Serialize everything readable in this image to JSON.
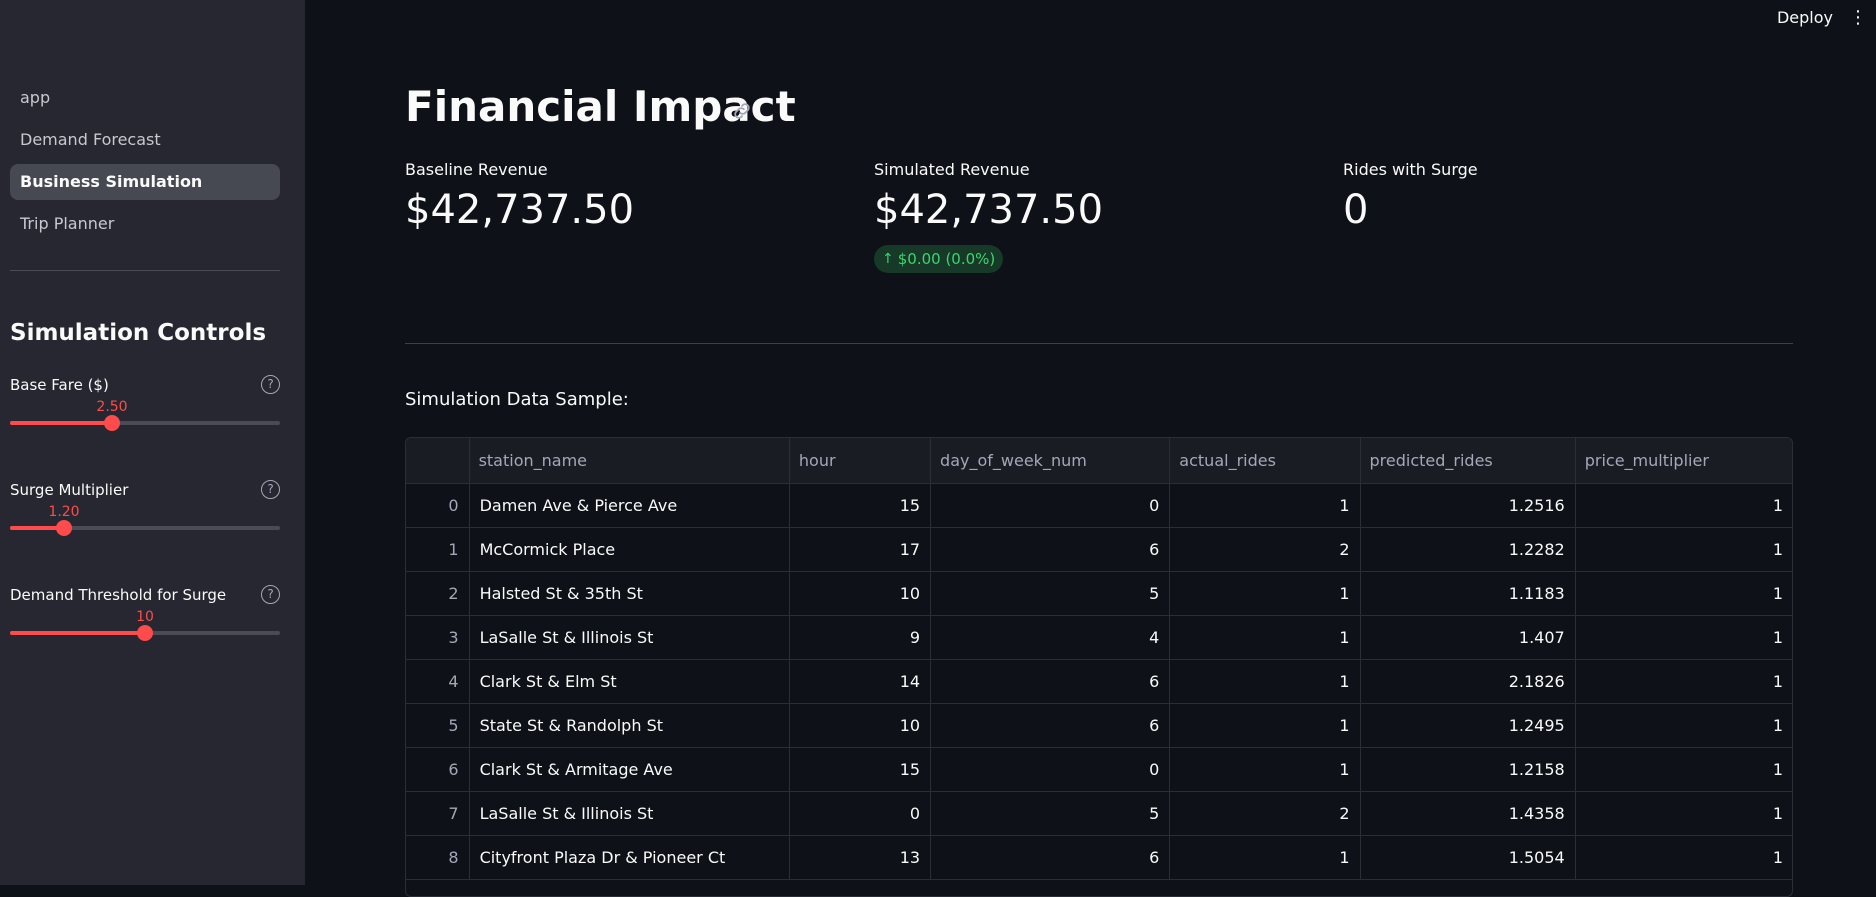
{
  "sidebar": {
    "nav": [
      "app",
      "Demand Forecast",
      "Business Simulation",
      "Trip Planner"
    ],
    "active_nav": "Business Simulation",
    "section_title": "Simulation Controls",
    "sliders": [
      {
        "label": "Base Fare ($)",
        "value": "2.50",
        "fraction": 0.38
      },
      {
        "label": "Surge Multiplier",
        "value": "1.20",
        "fraction": 0.2
      },
      {
        "label": "Demand Threshold for Surge",
        "value": "10",
        "fraction": 0.5
      }
    ],
    "help_icon": "?"
  },
  "topbar": {
    "deploy": "Deploy",
    "menu_icon": "⋮"
  },
  "main": {
    "title": "Financial Impact",
    "metrics": [
      {
        "label": "Baseline Revenue",
        "value": "$42,737.50"
      },
      {
        "label": "Simulated Revenue",
        "value": "$42,737.50",
        "delta": "$0.00 (0.0%)",
        "delta_arrow": "↑"
      },
      {
        "label": "Rides with Surge",
        "value": "0"
      }
    ],
    "section_label": "Simulation Data Sample:",
    "table": {
      "columns": [
        "",
        "station_name",
        "hour",
        "day_of_week_num",
        "actual_rides",
        "predicted_rides",
        "price_multiplier"
      ],
      "rows": [
        [
          "0",
          "Damen Ave & Pierce Ave",
          "15",
          "0",
          "1",
          "1.2516",
          "1"
        ],
        [
          "1",
          "McCormick Place",
          "17",
          "6",
          "2",
          "1.2282",
          "1"
        ],
        [
          "2",
          "Halsted St & 35th St",
          "10",
          "5",
          "1",
          "1.1183",
          "1"
        ],
        [
          "3",
          "LaSalle St & Illinois St",
          "9",
          "4",
          "1",
          "1.407",
          "1"
        ],
        [
          "4",
          "Clark St & Elm St",
          "14",
          "6",
          "1",
          "2.1826",
          "1"
        ],
        [
          "5",
          "State St & Randolph St",
          "10",
          "6",
          "1",
          "1.2495",
          "1"
        ],
        [
          "6",
          "Clark St & Armitage Ave",
          "15",
          "0",
          "1",
          "1.2158",
          "1"
        ],
        [
          "7",
          "LaSalle St & Illinois St",
          "0",
          "5",
          "2",
          "1.4358",
          "1"
        ],
        [
          "8",
          "Cityfront Plaza Dr & Pioneer Ct",
          "13",
          "6",
          "1",
          "1.5054",
          "1"
        ]
      ]
    }
  },
  "colors": {
    "accent": "#ff4b4b",
    "delta_positive": "#3dd56d",
    "background": "#0e1117",
    "sidebar": "#262730"
  },
  "icons": {
    "link": "link-icon",
    "help": "question-circle-icon",
    "menu": "vertical-dots-icon",
    "arrow": "arrow-up-icon"
  }
}
